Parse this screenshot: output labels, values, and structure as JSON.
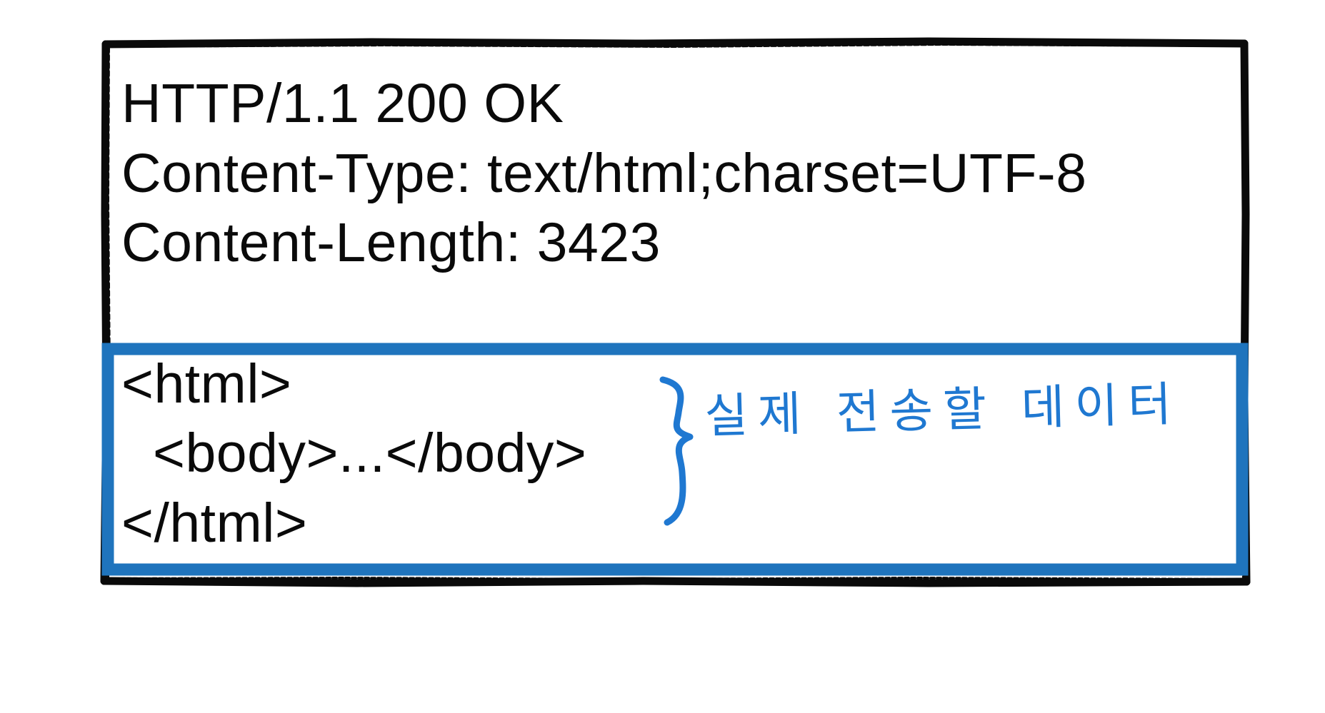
{
  "http_message": {
    "header": {
      "status_line": "HTTP/1.1 200 OK",
      "content_type": "Content-Type: text/html;charset=UTF-8",
      "content_length": "Content-Length: 3423"
    },
    "body": {
      "line_1": "<html>",
      "line_2": "<body>...</body>",
      "line_3": "</html>"
    },
    "annotation": "실제 전송할 데이터"
  },
  "colors": {
    "frame_border": "#0a0a0a",
    "body_border": "#1f74bd",
    "annotation": "#1f78d1"
  }
}
